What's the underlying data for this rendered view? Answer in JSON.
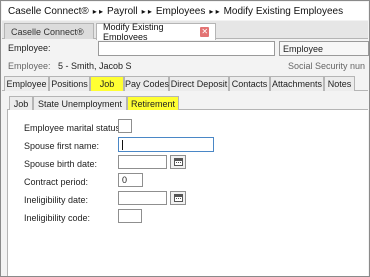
{
  "breadcrumb": {
    "items": [
      "Caselle Connect®",
      "Payroll",
      "Employees",
      "Modify Existing Employees"
    ],
    "separator": "▸ ▸"
  },
  "doc_tabs": [
    {
      "label": "Caselle Connect®"
    },
    {
      "label": "Modify Existing Employees",
      "close": "✕"
    }
  ],
  "employee": {
    "label": "Employee:",
    "value": "",
    "type_select": "Employee"
  },
  "employee_info": {
    "label": "Employee:",
    "value": "5 - Smith, Jacob S",
    "ssn_label": "Social Security nun"
  },
  "main_tabs": [
    "Employee",
    "Positions",
    "Job",
    "Pay Codes",
    "Direct Deposit",
    "Contacts",
    "Attachments",
    "Notes"
  ],
  "main_tabs_active": "Job",
  "sub_tabs": [
    "Job",
    "State Unemployment",
    "Retirement"
  ],
  "sub_tabs_active": "Retirement",
  "form": {
    "marital_status": {
      "label": "Employee marital status:",
      "value": ""
    },
    "spouse_first_name": {
      "label": "Spouse first name:",
      "value": ""
    },
    "spouse_birth_date": {
      "label": "Spouse birth date:",
      "value": ""
    },
    "contract_period": {
      "label": "Contract period:",
      "value": "0"
    },
    "ineligibility_date": {
      "label": "Ineligibility date:",
      "value": ""
    },
    "ineligibility_code": {
      "label": "Ineligibility code:",
      "value": ""
    }
  },
  "colors": {
    "active_tab": "#ffff33",
    "focus_border": "#4a87c6",
    "close_button": "#e37373"
  }
}
